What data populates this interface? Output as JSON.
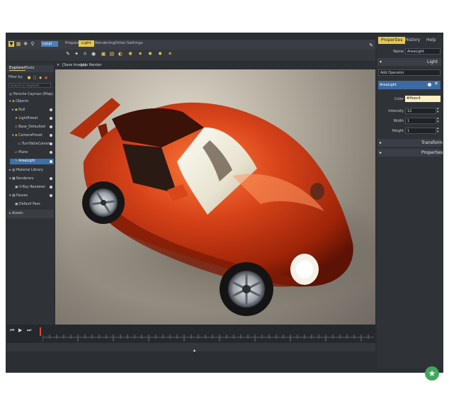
{
  "toolbar": {
    "local_label": "Local",
    "tabs": [
      "Prepare",
      "Light",
      "Rendering",
      "Other",
      "Settings"
    ],
    "active_tab": "Light"
  },
  "explorer": {
    "tabs": [
      "Explorer",
      "Tools"
    ],
    "filter_label": "Filter by:",
    "search_placeholder": "Search in explorer",
    "root": "Porsche Cayman (Rfap)",
    "items": [
      "Objects",
      "Null",
      "LightPreset",
      "Base_Defaulted",
      "CameraPreset",
      "TurnTableCamera",
      "Plane",
      "AreaLight",
      "Material Library",
      "Renderers",
      "V-Ray Renderer",
      "Passes",
      "Default Pass",
      "Assets"
    ],
    "selected": "AreaLight"
  },
  "viewport": {
    "save_image": "[Save Image]",
    "live_render": "Live Render"
  },
  "properties": {
    "tabs": [
      "Properties",
      "History",
      "Help"
    ],
    "active_tab": "Properties",
    "name_label": "Name",
    "name_value": "AreaLight",
    "section_light": "Light",
    "add_operator": "Add Operator",
    "operator_item": "AreaLight",
    "color_label": "Color",
    "color_value": "#ffeec4",
    "intensity_label": "Intensity",
    "intensity_value": "12",
    "width_label": "Width",
    "width_value": "1",
    "height_label": "Height",
    "height_value": "1",
    "section_transform": "Transform",
    "section_properties": "Properties"
  },
  "colors": {
    "accent": "#e7c84a",
    "selection": "#3f6fa8",
    "car": "#c63a10",
    "badge": "#3fa65a"
  }
}
